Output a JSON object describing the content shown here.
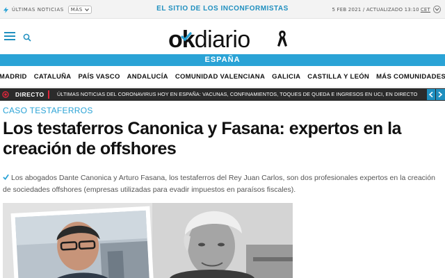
{
  "topbar": {
    "latest_label": "ÚLTIMAS NOTICIAS",
    "more_label": "MÁS",
    "tagline": "EL SITIO DE LOS INCONFORMISTAS",
    "date": "5 FEB 2021 / ACTUALIZADO 13:10",
    "timezone": "CET"
  },
  "header": {
    "logo_ok": "ok",
    "logo_diario": "diario"
  },
  "section": {
    "title": "ESPAÑA"
  },
  "regions": [
    "MADRID",
    "CATALUÑA",
    "PAÍS VASCO",
    "ANDALUCÍA",
    "COMUNIDAD VALENCIANA",
    "GALICIA",
    "CASTILLA Y LEÓN",
    "MÁS COMUNIDADES"
  ],
  "ticker": {
    "live_label": "DIRECTO",
    "text": "ÚLTIMAS NOTICIAS DEL CORONAVIRUS HOY EN ESPAÑA: VACUNAS, CONFINAMIENTOS, TOQUES DE QUEDA E INGRESOS EN UCI, EN DIRECTO"
  },
  "article": {
    "kicker": "CASO TESTAFERROS",
    "headline": "Los testaferros Canonica y Fasana: expertos en la creación de offshores",
    "summary": "Los abogados Dante Canonica y Arturo Fasana, los testaferros del Rey Juan Carlos, son dos profesionales expertos en la creación de sociedades offshores (empresas utilizadas para evadir impuestos en paraísos fiscales)."
  },
  "colors": {
    "brand_blue": "#2aa3d6",
    "accent_red": "#e0263b",
    "ticker_bg": "#2b2b2b"
  },
  "icons": [
    "bolt-icon",
    "chevron-down-icon",
    "expand-icon",
    "menu-icon",
    "search-icon",
    "check-icon",
    "mourning-ribbon-icon",
    "live-icon",
    "arrow-left-icon",
    "arrow-right-icon"
  ]
}
